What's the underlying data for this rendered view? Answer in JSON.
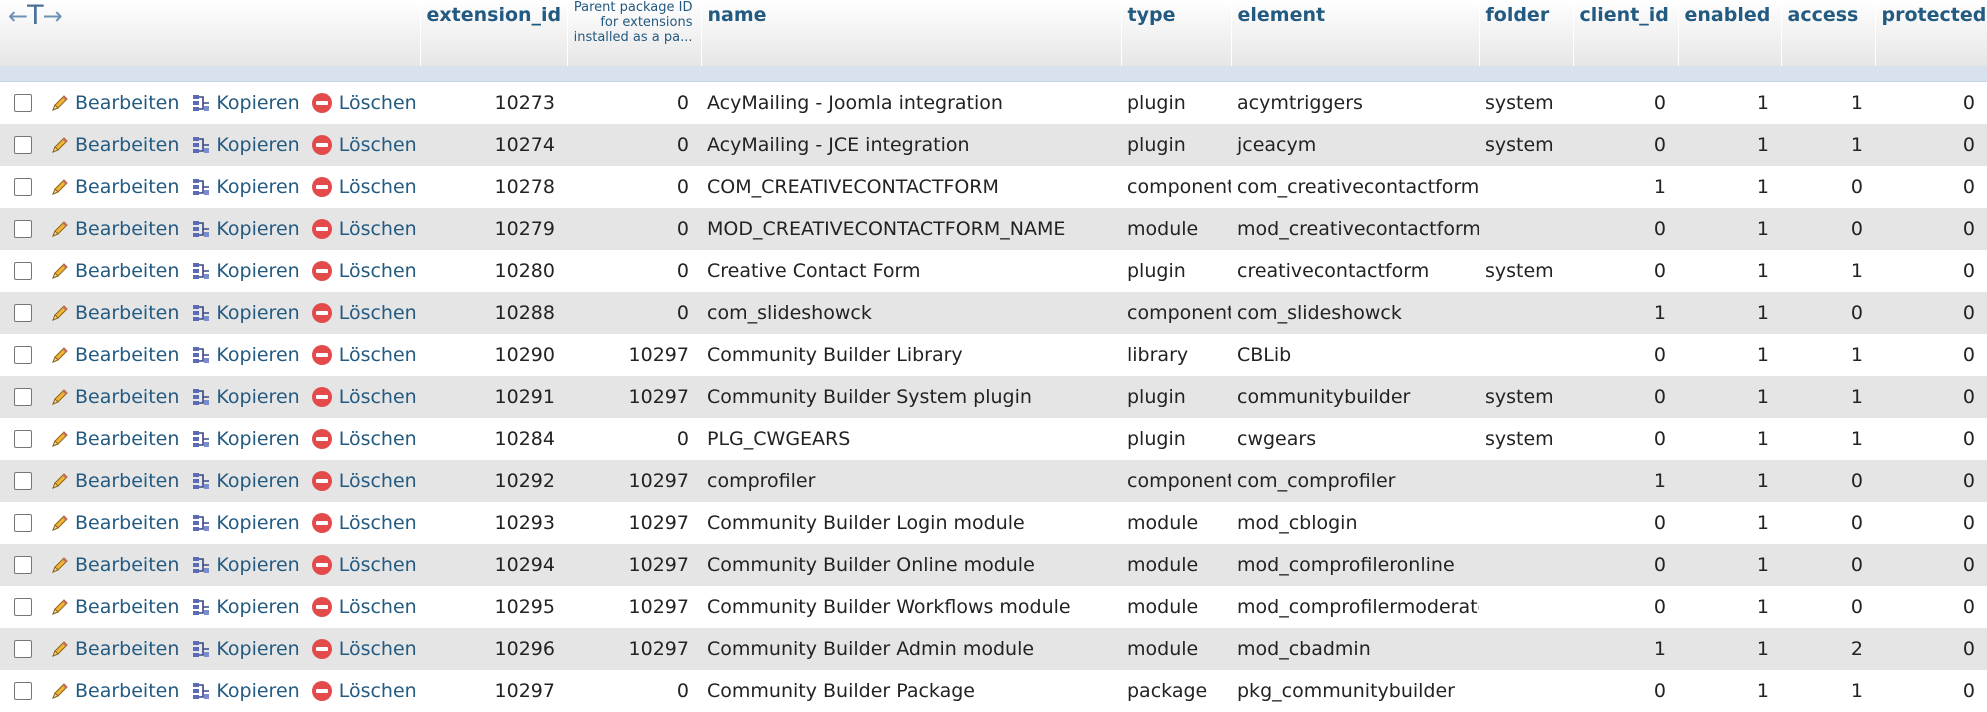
{
  "header": {
    "arrows": [
      "←",
      "T",
      "→"
    ],
    "columns": {
      "extension_id": "extension_id",
      "package_id": "Parent package ID for extensions installed as a pa...",
      "name": "name",
      "type": "type",
      "element": "element",
      "folder": "folder",
      "client_id": "client_id",
      "enabled": "enabled",
      "access": "access",
      "protected": "protected"
    }
  },
  "actions": {
    "edit": "Bearbeiten",
    "copy": "Kopieren",
    "delete": "Löschen"
  },
  "rows": [
    {
      "extension_id": "10273",
      "package_id": "0",
      "name": "AcyMailing - Joomla integration",
      "type": "plugin",
      "element": "acymtriggers",
      "folder": "system",
      "client_id": "0",
      "enabled": "1",
      "access": "1",
      "protected": "0"
    },
    {
      "extension_id": "10274",
      "package_id": "0",
      "name": "AcyMailing - JCE integration",
      "type": "plugin",
      "element": "jceacym",
      "folder": "system",
      "client_id": "0",
      "enabled": "1",
      "access": "1",
      "protected": "0"
    },
    {
      "extension_id": "10278",
      "package_id": "0",
      "name": "COM_CREATIVECONTACTFORM",
      "type": "component",
      "element": "com_creativecontactform",
      "folder": "",
      "client_id": "1",
      "enabled": "1",
      "access": "0",
      "protected": "0"
    },
    {
      "extension_id": "10279",
      "package_id": "0",
      "name": "MOD_CREATIVECONTACTFORM_NAME",
      "type": "module",
      "element": "mod_creativecontactform",
      "folder": "",
      "client_id": "0",
      "enabled": "1",
      "access": "0",
      "protected": "0"
    },
    {
      "extension_id": "10280",
      "package_id": "0",
      "name": "Creative Contact Form",
      "type": "plugin",
      "element": "creativecontactform",
      "folder": "system",
      "client_id": "0",
      "enabled": "1",
      "access": "1",
      "protected": "0"
    },
    {
      "extension_id": "10288",
      "package_id": "0",
      "name": "com_slideshowck",
      "type": "component",
      "element": "com_slideshowck",
      "folder": "",
      "client_id": "1",
      "enabled": "1",
      "access": "0",
      "protected": "0"
    },
    {
      "extension_id": "10290",
      "package_id": "10297",
      "name": "Community Builder Library",
      "type": "library",
      "element": "CBLib",
      "folder": "",
      "client_id": "0",
      "enabled": "1",
      "access": "1",
      "protected": "0"
    },
    {
      "extension_id": "10291",
      "package_id": "10297",
      "name": "Community Builder System plugin",
      "type": "plugin",
      "element": "communitybuilder",
      "folder": "system",
      "client_id": "0",
      "enabled": "1",
      "access": "1",
      "protected": "0"
    },
    {
      "extension_id": "10284",
      "package_id": "0",
      "name": "PLG_CWGEARS",
      "type": "plugin",
      "element": "cwgears",
      "folder": "system",
      "client_id": "0",
      "enabled": "1",
      "access": "1",
      "protected": "0"
    },
    {
      "extension_id": "10292",
      "package_id": "10297",
      "name": "comprofiler",
      "type": "component",
      "element": "com_comprofiler",
      "folder": "",
      "client_id": "1",
      "enabled": "1",
      "access": "0",
      "protected": "0"
    },
    {
      "extension_id": "10293",
      "package_id": "10297",
      "name": "Community Builder Login module",
      "type": "module",
      "element": "mod_cblogin",
      "folder": "",
      "client_id": "0",
      "enabled": "1",
      "access": "0",
      "protected": "0"
    },
    {
      "extension_id": "10294",
      "package_id": "10297",
      "name": "Community Builder Online module",
      "type": "module",
      "element": "mod_comprofileronline",
      "folder": "",
      "client_id": "0",
      "enabled": "1",
      "access": "0",
      "protected": "0"
    },
    {
      "extension_id": "10295",
      "package_id": "10297",
      "name": "Community Builder Workflows module",
      "type": "module",
      "element": "mod_comprofilermoderator",
      "folder": "",
      "client_id": "0",
      "enabled": "1",
      "access": "0",
      "protected": "0"
    },
    {
      "extension_id": "10296",
      "package_id": "10297",
      "name": "Community Builder Admin module",
      "type": "module",
      "element": "mod_cbadmin",
      "folder": "",
      "client_id": "1",
      "enabled": "1",
      "access": "2",
      "protected": "0"
    },
    {
      "extension_id": "10297",
      "package_id": "0",
      "name": "Community Builder Package",
      "type": "package",
      "element": "pkg_communitybuilder",
      "folder": "",
      "client_id": "0",
      "enabled": "1",
      "access": "1",
      "protected": "0"
    }
  ]
}
